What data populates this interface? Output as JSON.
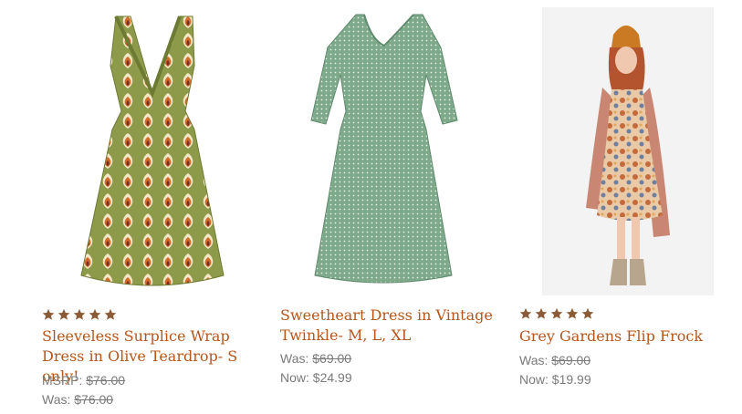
{
  "products": [
    {
      "name": "Sleeveless Surplice Wrap Dress in Olive Teardrop- S only!",
      "image_icon": "olive-teardrop-dress-photo",
      "rating_stars": 5,
      "prices": [
        {
          "label": "MSRP:",
          "value": "$76.00",
          "struck": true
        },
        {
          "label": "Was:",
          "value": "$76.00",
          "struck": true
        }
      ]
    },
    {
      "name": "Sweetheart Dress in Vintage Twinkle- M, L, XL",
      "image_icon": "green-dot-dress-photo",
      "rating_stars": 0,
      "prices": [
        {
          "label": "Was:",
          "value": "$69.00",
          "struck": true
        },
        {
          "label": "Now:",
          "value": "$24.99",
          "struck": false
        }
      ]
    },
    {
      "name": "Grey Gardens Flip Frock",
      "image_icon": "model-floral-dress-photo",
      "rating_stars": 5,
      "prices": [
        {
          "label": "Was:",
          "value": "$69.00",
          "struck": true
        },
        {
          "label": "Now:",
          "value": "$19.99",
          "struck": false
        }
      ]
    }
  ],
  "colors": {
    "title": "#b5561b",
    "star": "#8b5a36",
    "price": "#7a7a7a"
  }
}
